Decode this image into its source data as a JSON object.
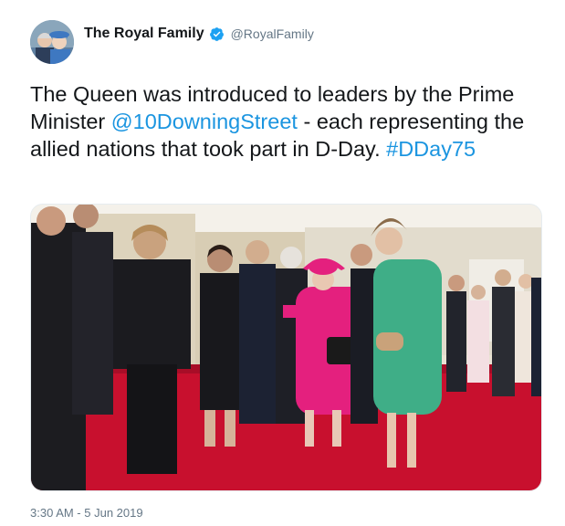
{
  "tweet": {
    "author": {
      "display_name": "The Royal Family",
      "handle": "@RoyalFamily",
      "verified": true,
      "avatar_icon": "avatar-photo-icon"
    },
    "text_parts": {
      "part1": "The Queen was introduced to leaders by the Prime Minister ",
      "mention": "@10DowningStreet",
      "part2": " - each representing the allied nations that took part in D-Day. ",
      "hashtag": "#DDay75"
    },
    "media": {
      "type": "photo",
      "icon": "photo-icon"
    },
    "timestamp": "3:30 AM - 5 Jun 2019"
  },
  "colors": {
    "link": "#1b95e0",
    "verified_badge": "#1da1f2",
    "muted_text": "#657786",
    "carpet_red": "#c8102e",
    "queen_pink": "#e4207e",
    "pm_green": "#3fae87"
  }
}
